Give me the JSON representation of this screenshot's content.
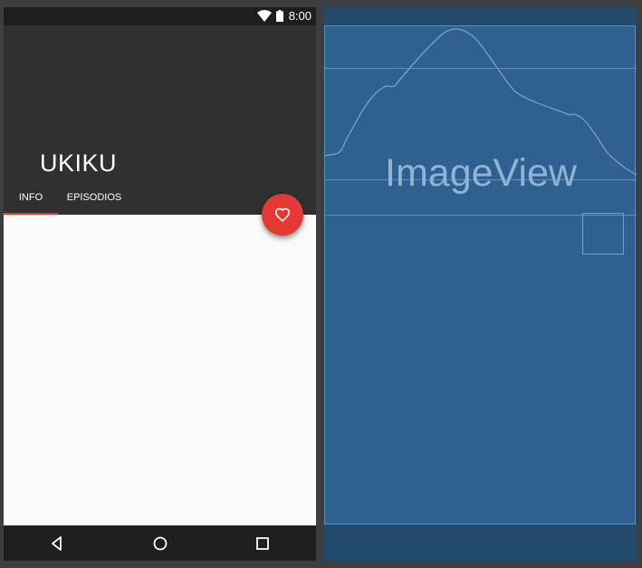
{
  "status_bar": {
    "time": "8:00",
    "icons": [
      "wifi-icon",
      "battery-icon"
    ]
  },
  "app_bar": {
    "title": "UKIKU"
  },
  "tabs": [
    {
      "label": "INFO",
      "selected": true
    },
    {
      "label": "EPISODIOS",
      "selected": false
    }
  ],
  "fab": {
    "icon": "heart-outline-icon",
    "color": "#e53935"
  },
  "navigation_bar": {
    "buttons": [
      "back-icon",
      "home-icon",
      "recent-apps-icon"
    ]
  },
  "blueprint": {
    "placeholder_label": "ImageView"
  },
  "colors": {
    "accent": "#e53935",
    "app_bar": "#303030",
    "content": "#fafafa",
    "blueprint_bg": "#2e6190",
    "blueprint_frame": "#23496b"
  }
}
